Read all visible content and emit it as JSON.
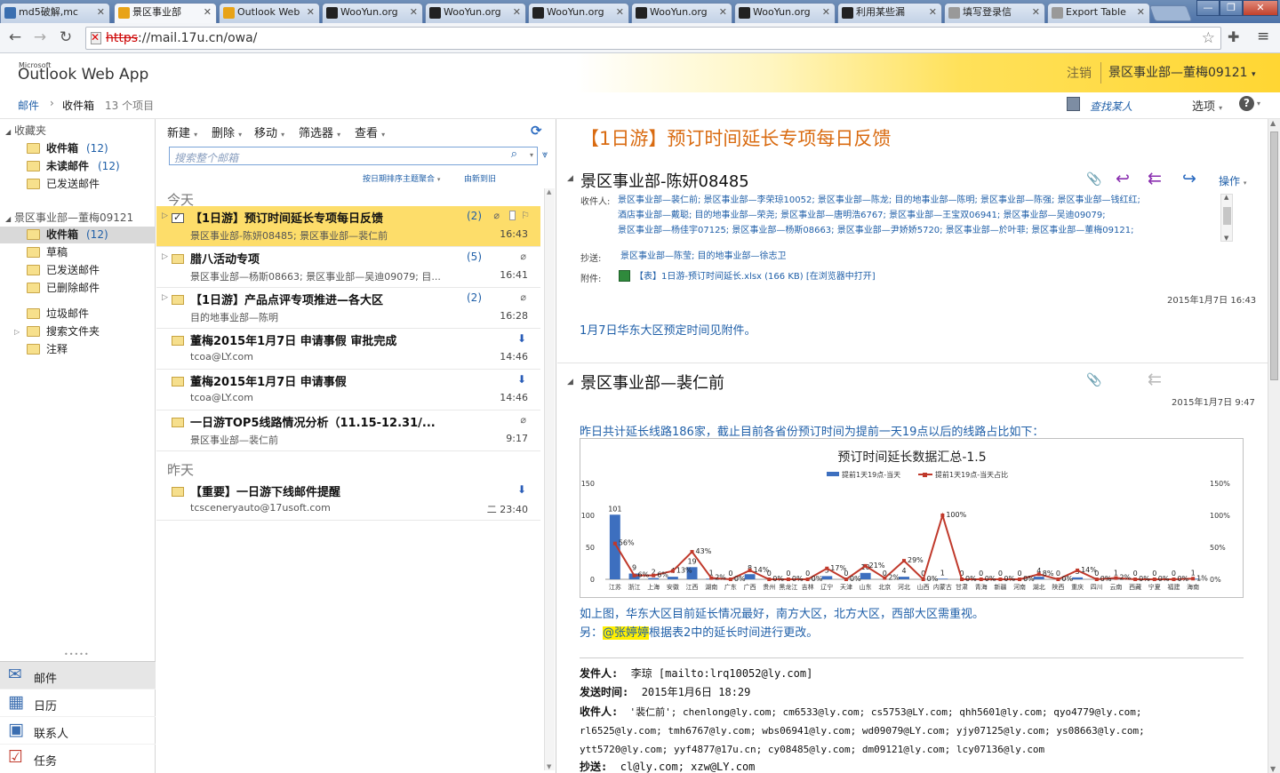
{
  "browser": {
    "tabs": [
      {
        "label": "md5破解,mc",
        "icon_color": "#3a6fb0"
      },
      {
        "label": "景区事业部",
        "icon_color": "#e8a317",
        "active": true
      },
      {
        "label": "Outlook Web",
        "icon_color": "#e8a317"
      },
      {
        "label": "WooYun.org",
        "icon_color": "#222222"
      },
      {
        "label": "WooYun.org",
        "icon_color": "#222222"
      },
      {
        "label": "WooYun.org",
        "icon_color": "#222222"
      },
      {
        "label": "WooYun.org",
        "icon_color": "#222222"
      },
      {
        "label": "WooYun.org",
        "icon_color": "#222222"
      },
      {
        "label": "利用某些漏",
        "icon_color": "#222222"
      },
      {
        "label": "填写登录信",
        "icon_color": "#999999"
      },
      {
        "label": "Export Table",
        "icon_color": "#999999"
      }
    ],
    "url_scheme": "https",
    "url_rest": "://mail.17u.cn/owa/"
  },
  "owa": {
    "logo_small": "Microsoft",
    "logo": "Outlook Web App",
    "signout": "注销",
    "user": "景区事业部—董梅09121",
    "breadcrumb": {
      "root": "邮件",
      "folder": "收件箱",
      "count": "13 个项目"
    },
    "find_someone": "查找某人",
    "options": "选项",
    "help": "?"
  },
  "leftnav": {
    "favorites_label": "收藏夹",
    "favorites": [
      {
        "label": "收件箱",
        "count": "(12)",
        "bold": true
      },
      {
        "label": "未读邮件",
        "count": "(12)",
        "bold": true
      },
      {
        "label": "已发送邮件",
        "count": "",
        "bold": false
      }
    ],
    "mailbox_label": "景区事业部—董梅09121",
    "folders": [
      {
        "label": "收件箱",
        "count": "(12)",
        "bold": true
      },
      {
        "label": "草稿",
        "count": "",
        "bold": false
      },
      {
        "label": "已发送邮件",
        "count": "",
        "bold": false
      },
      {
        "label": "已删除邮件",
        "count": "",
        "bold": false
      },
      {
        "label": "垃圾邮件",
        "count": "",
        "bold": false
      },
      {
        "label": "搜索文件夹",
        "count": "",
        "bold": false
      },
      {
        "label": "注释",
        "count": "",
        "bold": false
      }
    ],
    "dots": "•••••",
    "bottom": [
      {
        "label": "邮件"
      },
      {
        "label": "日历"
      },
      {
        "label": "联系人"
      },
      {
        "label": "任务"
      }
    ]
  },
  "list": {
    "toolbar": {
      "new": "新建",
      "delete": "删除",
      "move": "移动",
      "filter": "筛选器",
      "view": "查看"
    },
    "search_placeholder": "搜索整个邮箱",
    "sort_left": "按日期排序主题聚合",
    "sort_right": "由新到旧",
    "group_today": "今天",
    "group_yesterday": "昨天",
    "messages": [
      {
        "subject": "【1日游】预订时间延长专项每日反馈",
        "from": "景区事业部-陈妍08485; 景区事业部—裴仁前",
        "time": "16:43",
        "count": "(2)"
      },
      {
        "subject": "腊八活动专项",
        "from": "景区事业部—杨斯08663; 景区事业部—吴迪09079; 目...",
        "time": "16:41",
        "count": "(5)"
      },
      {
        "subject": "【1日游】产品点评专项推进—各大区",
        "from": "目的地事业部—陈明",
        "time": "16:28",
        "count": "(2)"
      },
      {
        "subject": "董梅2015年1月7日 申请事假 审批完成",
        "from": "tcoa@LY.com",
        "time": "14:46",
        "count": ""
      },
      {
        "subject": "董梅2015年1月7日 申请事假",
        "from": "tcoa@LY.com",
        "time": "14:46",
        "count": ""
      },
      {
        "subject": "一日游TOP5线路情况分析（11.15-12.31/...",
        "from": "景区事业部—裴仁前",
        "time": "9:17",
        "count": ""
      },
      {
        "subject": "【重要】一日游下线邮件提醒",
        "from": "tcsceneryauto@17usoft.com",
        "time": "二 23:40",
        "count": ""
      }
    ]
  },
  "reading": {
    "title": "【1日游】预订时间延长专项每日反馈",
    "msg1": {
      "sender": "景区事业部-陈妍08485",
      "actions": "操作",
      "to_label": "收件人:",
      "to_line1": "景区事业部—裴仁前; 景区事业部—李荣琼10052; 景区事业部—陈龙; 目的地事业部—陈明; 景区事业部—陈强; 景区事业部—钱红红;",
      "to_line2": "酒店事业部—戴聪; 目的地事业部—荣尧; 景区事业部—唐明浩6767; 景区事业部—王宝双06941; 景区事业部—吴迪09079;",
      "to_line3": "景区事业部—杨佳宇07125; 景区事业部—杨斯08663; 景区事业部—尹娇娇5720; 景区事业部—於叶菲; 景区事业部—董梅09121;",
      "cc_label": "抄送:",
      "cc": "景区事业部—陈莹; 目的地事业部—徐志卫",
      "att_label": "附件:",
      "attachment": "【表】1日游-预订时间延长.xlsx (166 KB) [在浏览器中打开]",
      "date": "2015年1月7日 16:43",
      "body": "1月7日华东大区预定时间见附件。"
    },
    "msg2": {
      "sender": "景区事业部—裴仁前",
      "date": "2015年1月7日 9:47",
      "intro": "昨日共计延长线路186家，截止目前各省份预订时间为提前一天19点以后的线路占比如下：",
      "after1": "如上图，华东大区目前延长情况最好，南方大区，北方大区，西部大区需重视。",
      "after2_prefix": "另：",
      "mention": "@张婷婷",
      "after2_suffix": "根据表2中的延长时间进行更改。",
      "from_label": "发件人:",
      "from_value": "李琼 [mailto:lrq10052@ly.com]",
      "sent_label": "发送时间:",
      "sent_value": "2015年1月6日 18:29",
      "to_label": "收件人:",
      "to_value1": "'裴仁前';  chenlong@ly.com;  cm6533@ly.com;  cs5753@LY.com;  qhh5601@ly.com;  qyo4779@ly.com;",
      "to_value2": "rl6525@ly.com;  tmh6767@ly.com;  wbs06941@ly.com;  wd09079@LY.com;  yjy07125@ly.com;  ys08663@ly.com;",
      "to_value3": "ytt5720@ly.com; yyf4877@17u.cn; cy08485@ly.com; dm09121@ly.com; lcy07136@ly.com",
      "cc_label": "抄送:",
      "cc_value": "cl@ly.com; xzw@LY.com"
    }
  },
  "chart_data": {
    "type": "bar",
    "title": "预订时间延长数据汇总-1.5",
    "categories": [
      "江苏",
      "浙江",
      "上海",
      "安徽",
      "江西",
      "湖南",
      "广东",
      "广西",
      "贵州",
      "黑龙江",
      "吉林",
      "辽宁",
      "天津",
      "山东",
      "北京",
      "河北",
      "山西",
      "内蒙古",
      "甘肃",
      "青海",
      "新疆",
      "河南",
      "湖北",
      "陕西",
      "重庆",
      "四川",
      "云南",
      "西藏",
      "宁夏",
      "福建",
      "海南"
    ],
    "series": [
      {
        "name": "提前1天19点-当天",
        "type": "bar",
        "axis": "left",
        "color": "#3d6fbf",
        "values": [
          101,
          9,
          2,
          4,
          19,
          1,
          0,
          8,
          0,
          0,
          0,
          5,
          0,
          10,
          0,
          4,
          0,
          1,
          0,
          0,
          0,
          0,
          4,
          0,
          3,
          0,
          1,
          0,
          0,
          0,
          1
        ],
        "labels": [
          "101",
          "9",
          "2",
          "4",
          "19",
          "1",
          "0",
          "8",
          "0",
          "0",
          "0",
          "5",
          "0",
          "10",
          "0",
          "4",
          "0",
          "1",
          "0",
          "0",
          "0",
          "0",
          "4",
          "0",
          "3",
          "0",
          "1",
          "0",
          "0",
          "0",
          "1"
        ]
      },
      {
        "name": "提前1天19点-当天占比",
        "type": "line",
        "axis": "right",
        "color": "#c0392b",
        "values": [
          56,
          6,
          6,
          13,
          43,
          2,
          0,
          14,
          0,
          0,
          0,
          17,
          0,
          21,
          2,
          29,
          0,
          100,
          0,
          0,
          0,
          0,
          8,
          0,
          14,
          0,
          2,
          0,
          0,
          0,
          1
        ],
        "labels": [
          "56%",
          "6%",
          "6%",
          "13%",
          "43%",
          "2%",
          "0%",
          "14%",
          "0%",
          "0%",
          "0%",
          "17%",
          "0%",
          "21%",
          "2%",
          "29%",
          "0%",
          "100%",
          "0%",
          "0%",
          "0%",
          "0%",
          "8%",
          "0%",
          "14%",
          "0%",
          "2%",
          "0%",
          "0%",
          "0%",
          "1%"
        ]
      }
    ],
    "ylim": [
      0,
      150
    ],
    "yticks": [
      "0",
      "50",
      "100",
      "150"
    ],
    "y2lim": [
      0,
      150
    ],
    "y2ticks": [
      "0%",
      "50%",
      "100%",
      "150%"
    ],
    "legend": "top"
  }
}
